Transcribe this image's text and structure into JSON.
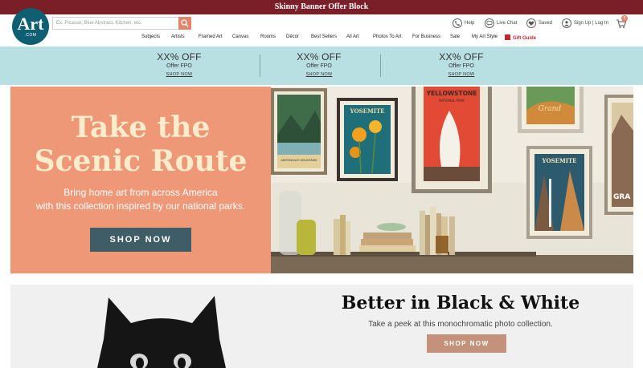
{
  "banner": {
    "text": "Skinny Banner Offer Block"
  },
  "logo": {
    "main": "Art",
    "sub": ".COM"
  },
  "search": {
    "placeholder": "Ex. Picasso, Blue Abstract, Kitchen, etc."
  },
  "utility": {
    "help": "Help",
    "live_chat": "Live Chat",
    "saved": "Saved",
    "account": "Sign Up | Log In",
    "cart_count": "0"
  },
  "nav": {
    "items": [
      "Subjects",
      "Artists",
      "Framed Art",
      "Canvas",
      "Rooms",
      "Décor",
      "Best Sellers",
      "All Art",
      "Photos To Art",
      "For Business",
      "Sale",
      "My Art Style"
    ],
    "gift_guide": "Gift Guide"
  },
  "offers": [
    {
      "pct": "XX% OFF",
      "fpo": "Offer FPO",
      "shop": "SHOP NOW"
    },
    {
      "pct": "XX% OFF",
      "fpo": "Offer FPO",
      "shop": "SHOP NOW"
    },
    {
      "pct": "XX% OFF",
      "fpo": "Offer FPO",
      "shop": "SHOP NOW"
    }
  ],
  "hero": {
    "title_line1": "Take the",
    "title_line2": "Scenic Route",
    "sub_line1": "Bring home art from across America",
    "sub_line2": "with this collection inspired by our national parks.",
    "button": "SHOP NOW",
    "posters": {
      "adirondack": "ADIRONDACK MOUNTAINS",
      "yosemite": "YOSEMITE",
      "yellowstone": "YELLOWSTONE",
      "yellowstone_sub": "NATIONAL PARK",
      "grand": "Grand",
      "yosemite2": "YOSEMITE",
      "gra": "GRA"
    }
  },
  "bw": {
    "title": "Better in Black & White",
    "sub": "Take a peek at this monochromatic photo collection.",
    "button": "SHOP NOW"
  },
  "colors": {
    "banner": "#7a1f28",
    "logo": "#0f5f72",
    "search_button": "#e2856a",
    "offer_band": "#b8dfe2",
    "hero_bg": "#ee9878",
    "hero_title": "#fbeccc",
    "hero_button": "#3f5d66",
    "bw_button": "#c4917a",
    "gift": "#c1272d"
  }
}
